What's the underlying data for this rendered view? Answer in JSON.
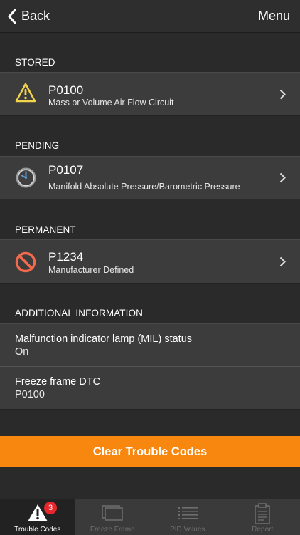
{
  "navbar": {
    "back_label": "Back",
    "menu_label": "Menu"
  },
  "sections": {
    "stored": {
      "header": "STORED",
      "code": "P0100",
      "description": "Mass or Volume Air Flow Circuit"
    },
    "pending": {
      "header": "PENDING",
      "code": "P0107",
      "description": "Manifold Absolute Pressure/Barometric Pressure"
    },
    "permanent": {
      "header": "PERMANENT",
      "code": "P1234",
      "description": "Manufacturer Defined"
    },
    "additional": {
      "header": "ADDITIONAL INFORMATION",
      "items": [
        {
          "label": "Malfunction indicator lamp (MIL) status",
          "value": "On"
        },
        {
          "label": "Freeze frame DTC",
          "value": "P0100"
        }
      ]
    }
  },
  "actions": {
    "clear_label": "Clear Trouble Codes"
  },
  "tabbar": {
    "tabs": [
      {
        "label": "Trouble Codes",
        "icon": "warning-icon",
        "badge": "3",
        "active": true
      },
      {
        "label": "Freeze Frame",
        "icon": "freeze-frame-icon"
      },
      {
        "label": "PID Values",
        "icon": "list-icon"
      },
      {
        "label": "Report",
        "icon": "clipboard-icon"
      }
    ]
  },
  "colors": {
    "accent": "#f7870f",
    "warning": "#f2d44b",
    "clock": "#5b9bd5",
    "permanent": "#f26a4b",
    "badge": "#e8262b"
  }
}
